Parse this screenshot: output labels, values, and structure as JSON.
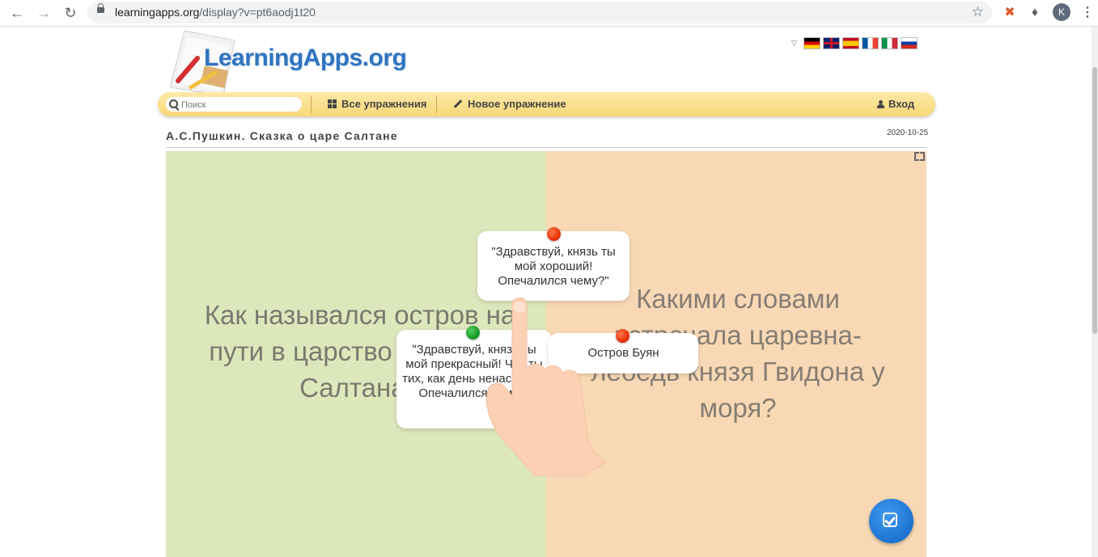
{
  "browser": {
    "url_host": "learningapps.org",
    "url_path": "/display?v=pt6aodj1t20",
    "avatar_letter": "K"
  },
  "site": {
    "logo_text": "LearningApps.org",
    "languages": [
      "de",
      "gb",
      "es",
      "fr",
      "it",
      "ru"
    ]
  },
  "nav": {
    "search_placeholder": "Поиск",
    "all_exercises": "Все упражнения",
    "new_exercise": "Новое упражнение",
    "login": "Вход"
  },
  "app": {
    "title": "А.С.Пушкин. Сказка о царе Салтане",
    "date": "2020-10-25",
    "question_left": "Как назывался остров на пути в царство славного Салтана?",
    "question_right": "Какими словами встречала царевна-лебедь князя Гвидона у моря?",
    "cards": [
      {
        "text": "\"Здравствуй, князь ты мой хороший! Опечалился чему?\"",
        "pin": "red"
      },
      {
        "text": "\"Здравствуй, князь ты мой прекрасный! Что ты тих, как день ненастный? Опечалился чему?\"",
        "pin": "green"
      },
      {
        "text": "Остров Буян",
        "pin": "red"
      }
    ]
  },
  "colors": {
    "left_panel": "#dde7bc",
    "right_panel": "#f9d9b5",
    "nav_bar": "#f8d878",
    "logo": "#2f74c0",
    "check_button": "#1a73d9"
  },
  "icons": [
    "back-icon",
    "forward-icon",
    "reload-icon",
    "lock-icon",
    "star-icon",
    "extension-icon",
    "puzzle-icon",
    "menu-icon",
    "search-icon",
    "grid-icon",
    "pencil-icon",
    "user-icon",
    "fullscreen-icon",
    "check-icon"
  ]
}
